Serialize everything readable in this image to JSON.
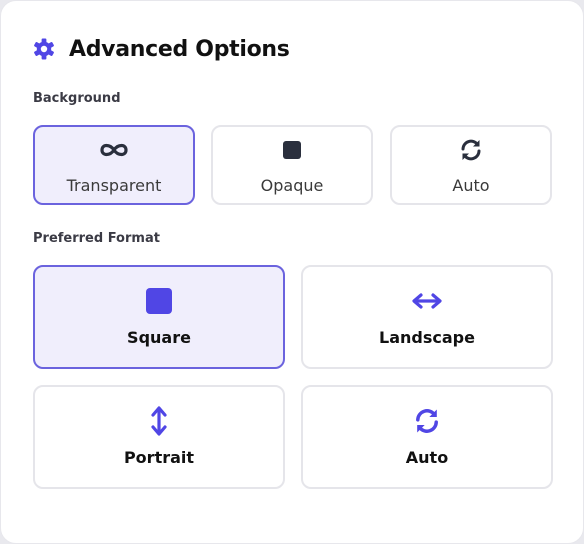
{
  "panel": {
    "title": "Advanced Options",
    "title_icon": "gear-icon",
    "accent_color": "#5046e5"
  },
  "background": {
    "label": "Background",
    "selected": "Transparent",
    "options": [
      {
        "label": "Transparent",
        "icon": "infinity-icon"
      },
      {
        "label": "Opaque",
        "icon": "square-icon"
      },
      {
        "label": "Auto",
        "icon": "refresh-icon"
      }
    ]
  },
  "format": {
    "label": "Preferred Format",
    "selected": "Square",
    "options": [
      {
        "label": "Square",
        "icon": "square-icon"
      },
      {
        "label": "Landscape",
        "icon": "horizontal-arrows-icon"
      },
      {
        "label": "Portrait",
        "icon": "vertical-arrows-icon"
      },
      {
        "label": "Auto",
        "icon": "refresh-icon"
      }
    ]
  }
}
